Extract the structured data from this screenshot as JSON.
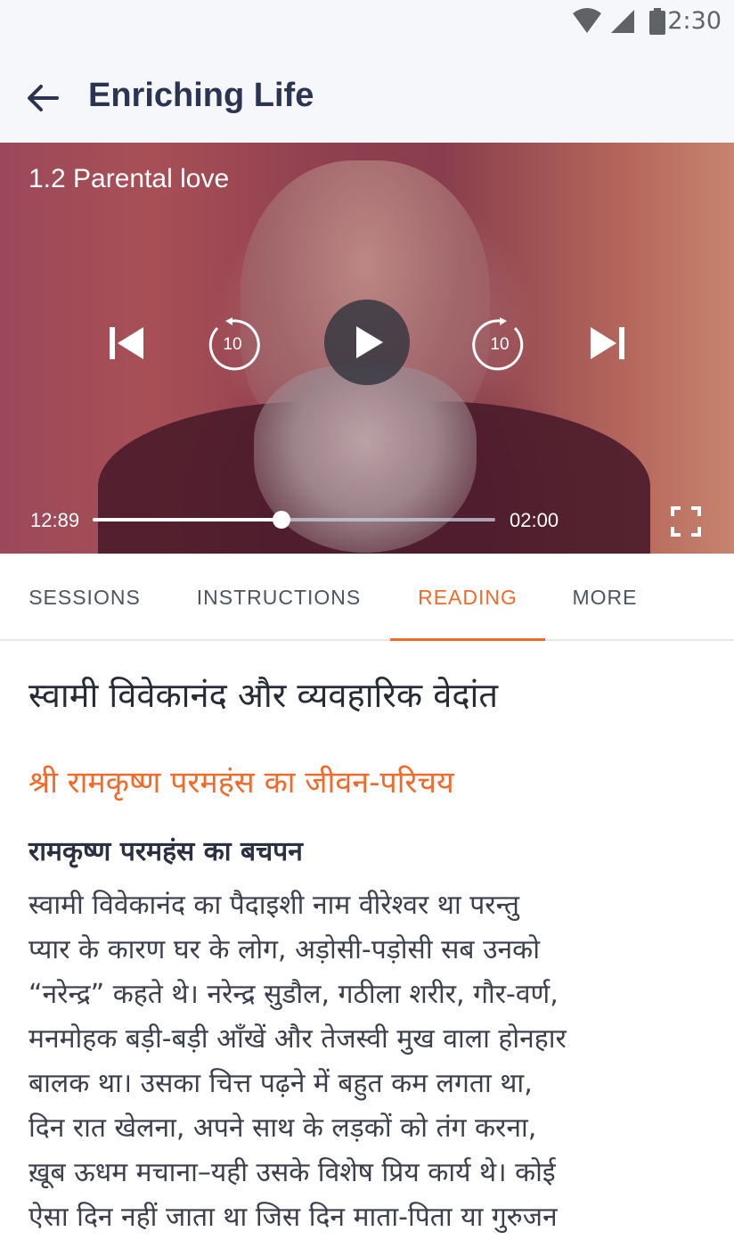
{
  "status_bar": {
    "time": "12:30",
    "icons": [
      "wifi-icon",
      "signal-icon",
      "battery-icon"
    ]
  },
  "app_bar": {
    "back_icon": "arrow-left-icon",
    "title": "Enriching Life"
  },
  "player": {
    "session_title": "1.2 Parental love",
    "controls": {
      "skip_previous_icon": "skip-previous-icon",
      "replay_label": "10",
      "play_icon": "play-icon",
      "forward_label": "10",
      "skip_next_icon": "skip-next-icon",
      "fullscreen_icon": "fullscreen-icon"
    },
    "elapsed": "12:89",
    "total": "02:00",
    "progress_fraction": 0.47
  },
  "tabs": [
    {
      "label": "SESSIONS",
      "active": false
    },
    {
      "label": "INSTRUCTIONS",
      "active": false
    },
    {
      "label": "READING",
      "active": true
    },
    {
      "label": "MORE",
      "active": false
    }
  ],
  "reading": {
    "title": "स्वामी विवेकानंद और व्यवहारिक वेदांत",
    "subtitle": "श्री रामकृष्ण परमहंस का जीवन-परिचय",
    "section_heading": "रामकृष्ण परमहंस का बचपन",
    "paragraph_lines": [
      "स्वामी विवेकानंद का पैदाइशी नाम वीरेश्वर था परन्तु",
      "प्यार के कारण घर के लोग, अड़ोसी-पड़ोसी सब उनको",
      "“नरेन्द्र” कहते थे। नरेन्द्र सुडौल, गठीला शरीर, गौर-वर्ण,",
      "मनमोहक बड़ी-बड़ी आँखें और तेजस्वी मुख वाला होनहार",
      "बालक था। उसका चित्त पढ़ने में बहुत कम लगता था,",
      "दिन रात खेलना, अपने साथ के लड़कों को तंग करना,",
      "ख़ूब ऊधम मचाना–यही उसके विशेष प्रिय कार्य थे। कोई",
      "ऐसा दिन नहीं जाता था जिस दिन माता-पिता या गुरुजन"
    ]
  },
  "colors": {
    "accent": "#f26a2a",
    "app_bar_bg": "#f5f7fa",
    "title_text": "#2b3552"
  }
}
